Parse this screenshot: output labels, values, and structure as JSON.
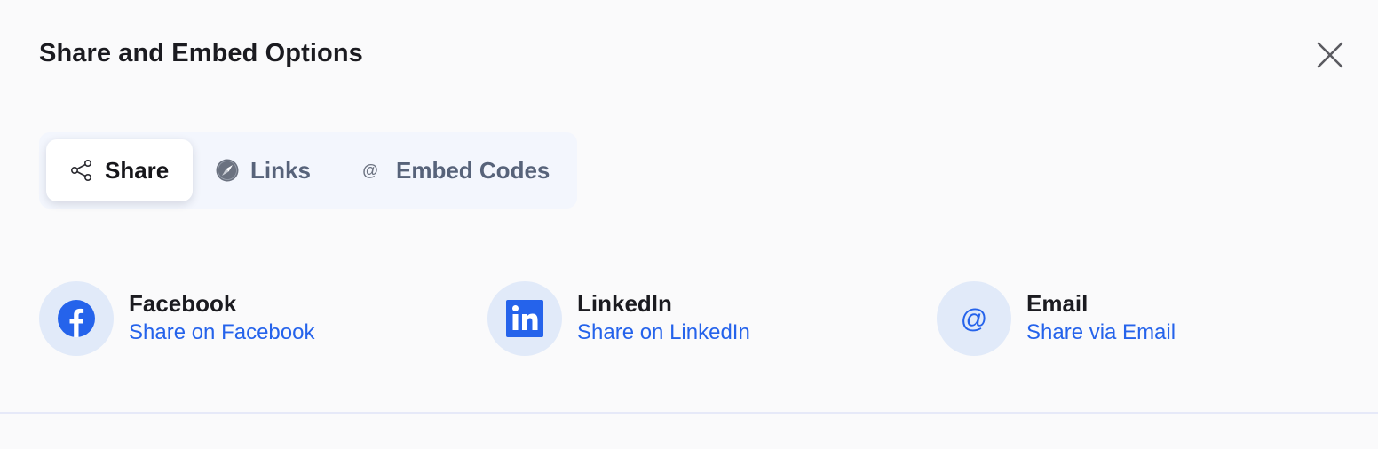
{
  "dialog": {
    "title": "Share and Embed Options",
    "close_icon": "close-icon"
  },
  "tabs": [
    {
      "label": "Share",
      "icon": "share-icon",
      "active": true
    },
    {
      "label": "Links",
      "icon": "compass-icon",
      "active": false
    },
    {
      "label": "Embed Codes",
      "icon": "at-icon",
      "active": false
    }
  ],
  "share_options": [
    {
      "title": "Facebook",
      "subtitle": "Share on Facebook",
      "icon": "facebook-icon"
    },
    {
      "title": "LinkedIn",
      "subtitle": "Share on LinkedIn",
      "icon": "linkedin-icon"
    },
    {
      "title": "Email",
      "subtitle": "Share via Email",
      "icon": "at-icon"
    }
  ],
  "colors": {
    "accent": "#2563eb",
    "icon_circle": "#e1eaf9",
    "tab_bar": "#f3f6fd",
    "background": "#fafafb"
  }
}
